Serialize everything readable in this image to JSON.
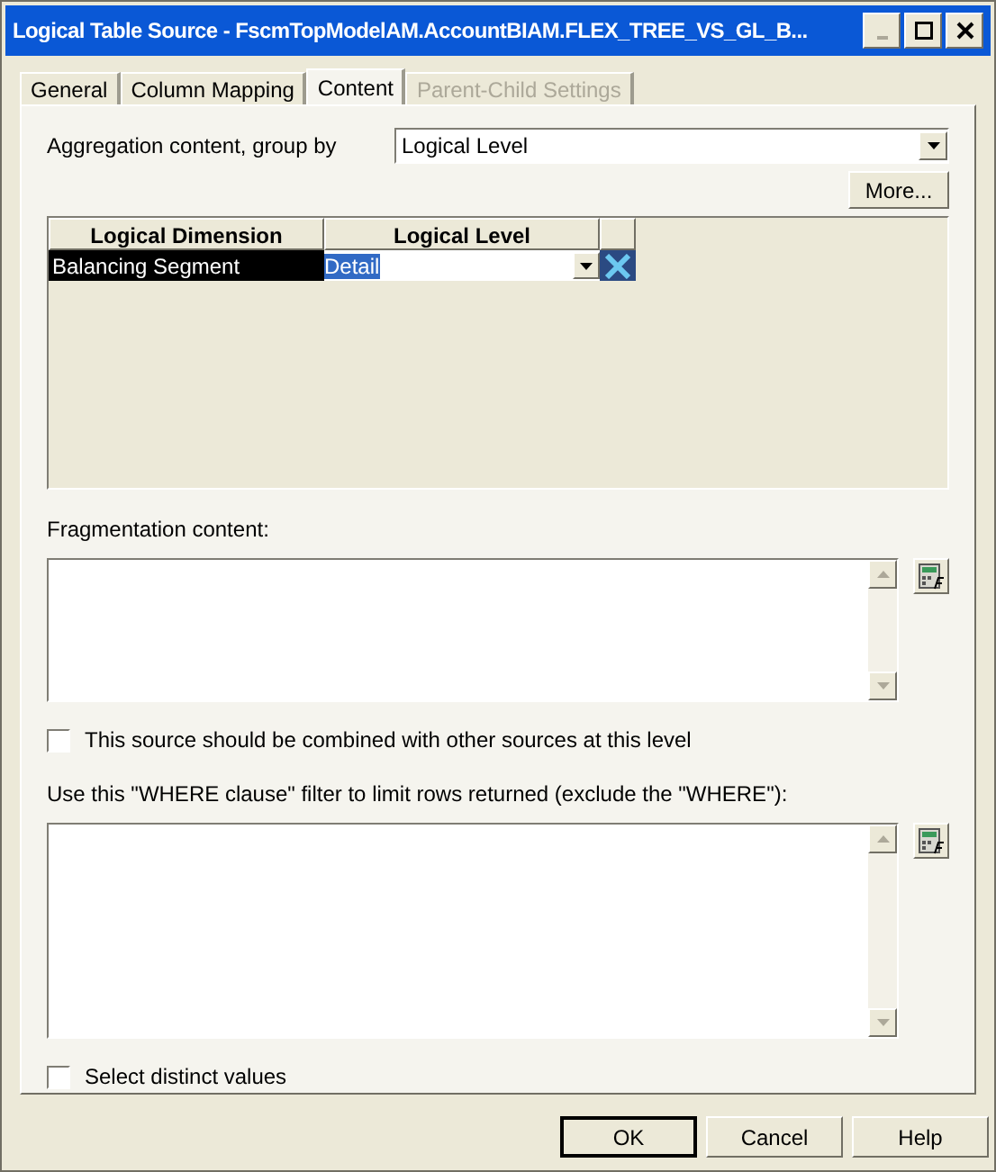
{
  "window": {
    "title": "Logical Table Source - FscmTopModelAM.AccountBIAM.FLEX_TREE_VS_GL_B..."
  },
  "tabs": [
    {
      "label": "General",
      "selected": false,
      "disabled": false
    },
    {
      "label": "Column Mapping",
      "selected": false,
      "disabled": false
    },
    {
      "label": "Content",
      "selected": true,
      "disabled": false
    },
    {
      "label": "Parent-Child Settings",
      "selected": false,
      "disabled": true
    }
  ],
  "aggregation": {
    "label": "Aggregation content, group by",
    "value": "Logical Level",
    "more_button": "More..."
  },
  "table": {
    "columns": [
      "Logical Dimension",
      "Logical Level"
    ],
    "rows": [
      {
        "dimension": "Balancing Segment",
        "level": "Detail",
        "selected": true
      }
    ]
  },
  "fragmentation": {
    "label": "Fragmentation content:"
  },
  "combine_checkbox": {
    "label": "This source should be combined with other sources at this level",
    "checked": false
  },
  "where": {
    "label": "Use this \"WHERE clause\" filter to limit rows returned (exclude the \"WHERE\"):"
  },
  "distinct_checkbox": {
    "label": "Select distinct values",
    "checked": false
  },
  "buttons": [
    "OK",
    "Cancel",
    "Help"
  ]
}
